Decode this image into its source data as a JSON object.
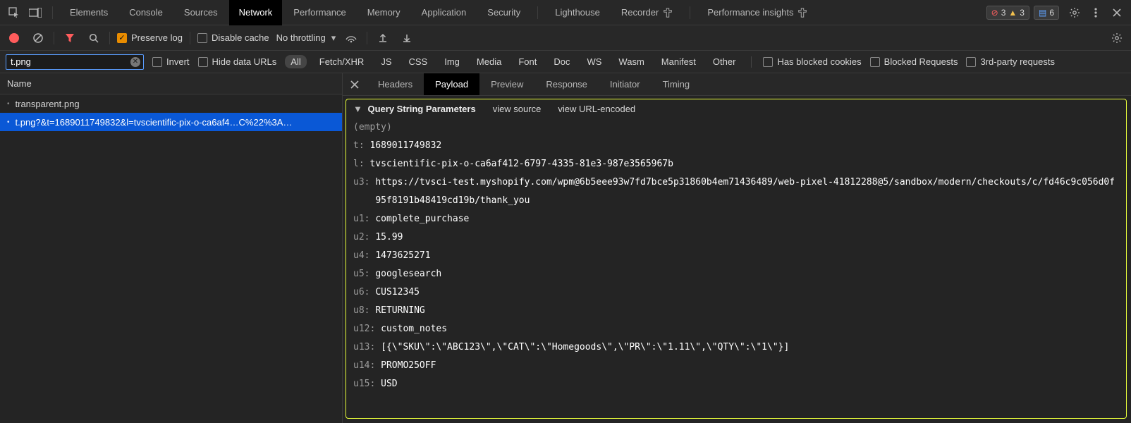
{
  "tabs": {
    "elements": "Elements",
    "console": "Console",
    "sources": "Sources",
    "network": "Network",
    "performance": "Performance",
    "memory": "Memory",
    "application": "Application",
    "security": "Security",
    "lighthouse": "Lighthouse",
    "recorder": "Recorder",
    "perf_insights": "Performance insights"
  },
  "badges": {
    "errors": "3",
    "warnings": "3",
    "messages": "6"
  },
  "controls": {
    "preserve_log": "Preserve log",
    "disable_cache": "Disable cache",
    "throttling": "No throttling"
  },
  "filter": {
    "value": "t.png",
    "invert": "Invert",
    "hide_data_urls": "Hide data URLs",
    "blocked_cookies": "Has blocked cookies",
    "blocked_requests": "Blocked Requests",
    "third_party": "3rd-party requests",
    "types": {
      "all": "All",
      "fetchxhr": "Fetch/XHR",
      "js": "JS",
      "css": "CSS",
      "img": "Img",
      "media": "Media",
      "font": "Font",
      "doc": "Doc",
      "ws": "WS",
      "wasm": "Wasm",
      "manifest": "Manifest",
      "other": "Other"
    }
  },
  "left": {
    "header": "Name",
    "items": [
      "transparent.png",
      "t.png?&t=1689011749832&l=tvscientific-pix-o-ca6af4…C%22%3A…"
    ]
  },
  "detail_tabs": {
    "headers": "Headers",
    "payload": "Payload",
    "preview": "Preview",
    "response": "Response",
    "initiator": "Initiator",
    "timing": "Timing"
  },
  "query_string": {
    "title": "Query String Parameters",
    "view_source": "view source",
    "view_url_encoded": "view URL-encoded",
    "empty_label": "(empty)",
    "params": [
      {
        "k": "t",
        "v": "1689011749832"
      },
      {
        "k": "l",
        "v": "tvscientific-pix-o-ca6af412-6797-4335-81e3-987e3565967b"
      },
      {
        "k": "u3",
        "v": "https://tvsci-test.myshopify.com/wpm@6b5eee93w7fd7bce5p31860b4em71436489/web-pixel-41812288@5/sandbox/modern/checkouts/c/fd46c9c056d0f95f8191b48419cd19b/thank_you",
        "wrap": true
      },
      {
        "k": "u1",
        "v": "complete_purchase"
      },
      {
        "k": "u2",
        "v": "15.99"
      },
      {
        "k": "u4",
        "v": "1473625271"
      },
      {
        "k": "u5",
        "v": "googlesearch"
      },
      {
        "k": "u6",
        "v": "CUS12345"
      },
      {
        "k": "u8",
        "v": "RETURNING"
      },
      {
        "k": "u12",
        "v": "custom_notes"
      },
      {
        "k": "u13",
        "v": "[{\\\"SKU\\\":\\\"ABC123\\\",\\\"CAT\\\":\\\"Homegoods\\\",\\\"PR\\\":\\\"1.11\\\",\\\"QTY\\\":\\\"1\\\"}]"
      },
      {
        "k": "u14",
        "v": "PROMO25OFF"
      },
      {
        "k": "u15",
        "v": "USD"
      }
    ]
  }
}
